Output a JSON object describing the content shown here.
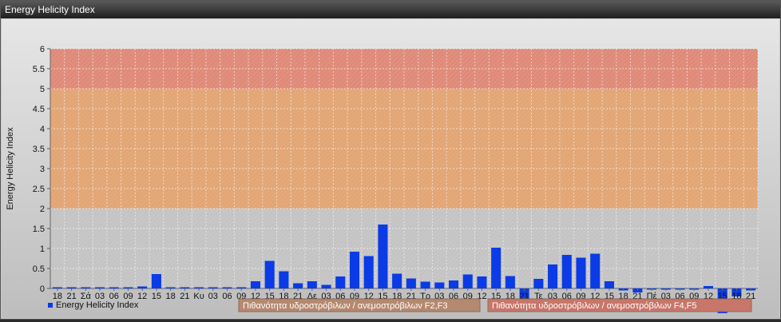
{
  "window": {
    "title": "Energy Helicity Index"
  },
  "chart_data": {
    "type": "bar",
    "ylabel": "Energy Helicity Index",
    "ylim": [
      0,
      6
    ],
    "yticks": [
      "0",
      "0.5",
      "1",
      "1.5",
      "2",
      "2.5",
      "3",
      "3.5",
      "4",
      "4.5",
      "5",
      "5.5",
      "6"
    ],
    "bands": [
      {
        "from": 0,
        "to": 2,
        "color": "#c4c4c4"
      },
      {
        "from": 2,
        "to": 5,
        "color": "#e2a574"
      },
      {
        "from": 5,
        "to": 6,
        "color": "#df8a78"
      }
    ],
    "categories": [
      "18",
      "21",
      "Σά",
      "03",
      "06",
      "09",
      "12",
      "15",
      "18",
      "21",
      "Κυ",
      "03",
      "06",
      "09",
      "12",
      "15",
      "18",
      "21",
      "Δε",
      "03",
      "06",
      "09",
      "12",
      "15",
      "18",
      "21",
      "Τρ",
      "03",
      "06",
      "09",
      "12",
      "15",
      "18",
      "21",
      "Τε",
      "03",
      "06",
      "09",
      "12",
      "15",
      "18",
      "21",
      "Πέ",
      "03",
      "06",
      "09",
      "12",
      "15",
      "18",
      "21"
    ],
    "series": [
      {
        "name": "Energy Helicity Index",
        "color": "#0a3be6",
        "values": [
          0.02,
          0.01,
          0.01,
          0.01,
          0.01,
          0.02,
          0.05,
          0.36,
          0.02,
          0.01,
          0.01,
          0.01,
          0.01,
          0.02,
          0.18,
          0.69,
          0.43,
          0.13,
          0.18,
          0.09,
          0.3,
          0.92,
          0.81,
          1.6,
          0.37,
          0.25,
          0.17,
          0.15,
          0.2,
          0.35,
          0.3,
          1.02,
          0.31,
          -0.3,
          0.24,
          0.6,
          0.84,
          0.77,
          0.87,
          0.18,
          -0.05,
          -0.1,
          -0.03,
          -0.03,
          -0.03,
          -0.03,
          0.06,
          -0.62,
          -0.2,
          -0.05
        ]
      }
    ],
    "legend": {
      "label": "Energy Helicity Index",
      "position": "bottom-left"
    },
    "annotations": [
      {
        "label": "Πιθανότητα υδροστρόβιλων / ανεμοστρόβιλων F2,F3",
        "color": "#b5896f"
      },
      {
        "label": "Πιθανότητα υδροστρόβιλων / ανεμοστρόβιλων F4,F5",
        "color": "#c8766a"
      }
    ]
  }
}
